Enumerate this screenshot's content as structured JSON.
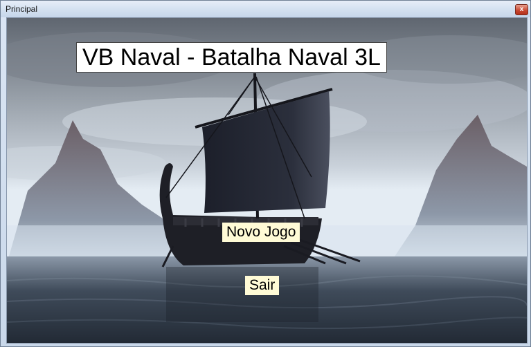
{
  "window": {
    "title": "Principal",
    "close_glyph": "x"
  },
  "game": {
    "title": "VB Naval - Batalha Naval 3L",
    "new_game_label": "Novo Jogo",
    "exit_label": "Sair"
  },
  "background": {
    "scene": "sailing-ship-between-mountains-on-sea"
  },
  "colors": {
    "title_bg": "#ffffff",
    "button_bg": "#fffbd6",
    "close_red": "#c7452f"
  }
}
